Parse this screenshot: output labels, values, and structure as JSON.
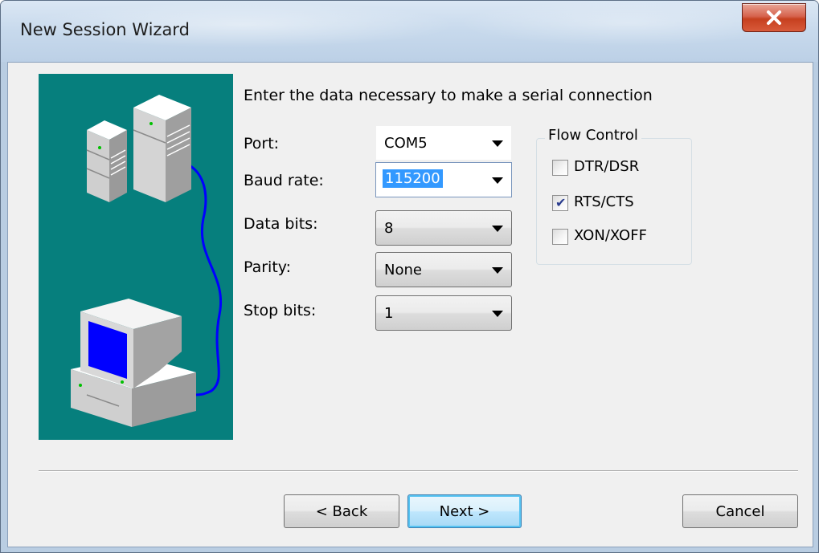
{
  "window": {
    "title": "New Session Wizard"
  },
  "heading": "Enter the data necessary to make a serial connection",
  "fields": {
    "port": {
      "label": "Port:",
      "value": "COM5"
    },
    "baud_rate": {
      "label": "Baud rate:",
      "value": "115200"
    },
    "data_bits": {
      "label": "Data bits:",
      "value": "8"
    },
    "parity": {
      "label": "Parity:",
      "value": "None"
    },
    "stop_bits": {
      "label": "Stop bits:",
      "value": "1"
    }
  },
  "flow_control": {
    "label": "Flow Control",
    "options": [
      {
        "label": "DTR/DSR",
        "checked": false
      },
      {
        "label": "RTS/CTS",
        "checked": true
      },
      {
        "label": "XON/XOFF",
        "checked": false
      }
    ]
  },
  "buttons": {
    "back": "< Back",
    "next": "Next >",
    "cancel": "Cancel"
  },
  "icons": {
    "close": "close-icon",
    "dropdown": "chevron-down-icon",
    "illustration": "serial-connection-illustration"
  },
  "colors": {
    "illustration_bg": "#067f7d",
    "cable": "#0000ff",
    "screen": "#0000ff",
    "selection": "#3399ff",
    "close_button": "#c6401f"
  }
}
